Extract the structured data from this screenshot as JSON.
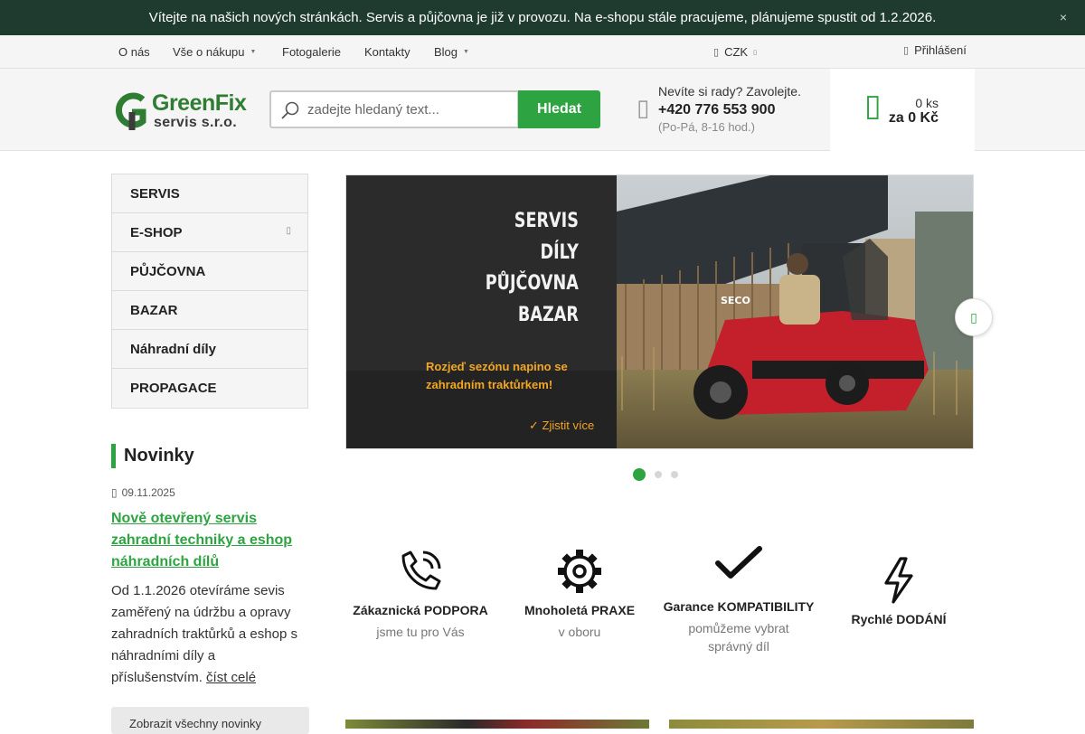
{
  "announcement": {
    "text": "Vítejte na našich nových stránkách. Servis a půjčovna je již v provozu. Na e-shopu stále pracujeme, plánujeme spustit od 1.2.2026.",
    "close_icon": "×"
  },
  "topnav": {
    "items": [
      {
        "label": "O nás"
      },
      {
        "label": "Vše o nákupu"
      },
      {
        "label": "Fotogalerie"
      },
      {
        "label": "Kontakty"
      },
      {
        "label": "Blog"
      }
    ],
    "currency": "CZK",
    "login": "Přihlášení"
  },
  "header": {
    "logo_name": "GreenFix",
    "logo_sub": "servis s.r.o.",
    "search_placeholder": "zadejte hledaný text...",
    "search_button": "Hledat",
    "contact_question": "Nevíte si rady? Zavolejte.",
    "contact_phone": "+420 776 553 900",
    "contact_hours": "(Po-Pá, 8-16 hod.)",
    "cart_qty": "0 ks",
    "cart_total": "za 0 Kč",
    "brand_color": "#2ea342"
  },
  "sidebar": {
    "categories": [
      {
        "label": "SERVIS"
      },
      {
        "label": "E-SHOP"
      },
      {
        "label": "PŮJČOVNA"
      },
      {
        "label": "BAZAR"
      },
      {
        "label": "Náhradní díly"
      },
      {
        "label": "PROPAGACE"
      }
    ],
    "news_heading": "Novinky",
    "news": {
      "date": "09.11.2025",
      "title": "Nově otevřený servis zahradní techniky a eshop náhradních dílů",
      "text": "Od 1.1.2026 otevíráme sevis zaměřený na údržbu a opravy zahradních traktůrků a eshop s náhradními díly a příslušenstvím.",
      "read_more": "číst celé"
    },
    "all_news": "Zobrazit všechny novinky"
  },
  "banner": {
    "words": [
      "SERVIS",
      "DÍLY",
      "PŮJČOVNA",
      "BAZAR"
    ],
    "promo_line1": "Rozjeď sezónu napino se",
    "promo_line2": "zahradním traktůrkem!",
    "more": "✓ Zjistit více",
    "brand_on_mower": "SECO",
    "active_slide": 1,
    "slide_count": 3
  },
  "benefits": [
    {
      "icon": "phone-icon",
      "title": "Zákaznická PODPORA",
      "subtitle": "jsme tu pro Vás"
    },
    {
      "icon": "gear-icon",
      "title": "Mnoholetá PRAXE",
      "subtitle": "v oboru"
    },
    {
      "icon": "check-icon",
      "title": "Garance KOMPATIBILITY",
      "subtitle": "pomůžeme vybrat správný díl"
    },
    {
      "icon": "bolt-icon",
      "title": "Rychlé DODÁNÍ",
      "subtitle": ""
    }
  ]
}
